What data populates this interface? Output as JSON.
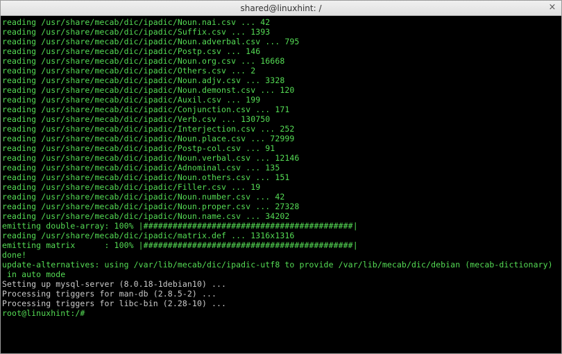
{
  "window": {
    "title": "shared@linuxhint: /",
    "close_glyph": "×"
  },
  "terminal": {
    "lines": [
      "reading /usr/share/mecab/dic/ipadic/Noun.nai.csv ... 42",
      "reading /usr/share/mecab/dic/ipadic/Suffix.csv ... 1393",
      "reading /usr/share/mecab/dic/ipadic/Noun.adverbal.csv ... 795",
      "reading /usr/share/mecab/dic/ipadic/Postp.csv ... 146",
      "reading /usr/share/mecab/dic/ipadic/Noun.org.csv ... 16668",
      "reading /usr/share/mecab/dic/ipadic/Others.csv ... 2",
      "reading /usr/share/mecab/dic/ipadic/Noun.adjv.csv ... 3328",
      "reading /usr/share/mecab/dic/ipadic/Noun.demonst.csv ... 120",
      "reading /usr/share/mecab/dic/ipadic/Auxil.csv ... 199",
      "reading /usr/share/mecab/dic/ipadic/Conjunction.csv ... 171",
      "reading /usr/share/mecab/dic/ipadic/Verb.csv ... 130750",
      "reading /usr/share/mecab/dic/ipadic/Interjection.csv ... 252",
      "reading /usr/share/mecab/dic/ipadic/Noun.place.csv ... 72999",
      "reading /usr/share/mecab/dic/ipadic/Postp-col.csv ... 91",
      "reading /usr/share/mecab/dic/ipadic/Noun.verbal.csv ... 12146",
      "reading /usr/share/mecab/dic/ipadic/Adnominal.csv ... 135",
      "reading /usr/share/mecab/dic/ipadic/Noun.others.csv ... 151",
      "reading /usr/share/mecab/dic/ipadic/Filler.csv ... 19",
      "reading /usr/share/mecab/dic/ipadic/Noun.number.csv ... 42",
      "reading /usr/share/mecab/dic/ipadic/Noun.proper.csv ... 27328",
      "reading /usr/share/mecab/dic/ipadic/Noun.name.csv ... 34202",
      "emitting double-array: 100% |###########################################|",
      "reading /usr/share/mecab/dic/ipadic/matrix.def ... 1316x1316",
      "emitting matrix      : 100% |###########################################|",
      "",
      "done!",
      "update-alternatives: using /var/lib/mecab/dic/ipadic-utf8 to provide /var/lib/mecab/dic/debian (mecab-dictionary)",
      " in auto mode"
    ],
    "gray_lines": [
      "Setting up mysql-server (8.0.18-1debian10) ...",
      "Processing triggers for man-db (2.8.5-2) ...",
      "Processing triggers for libc-bin (2.28-10) ..."
    ],
    "prompt": "root@linuxhint:/#",
    "cursor": " "
  }
}
